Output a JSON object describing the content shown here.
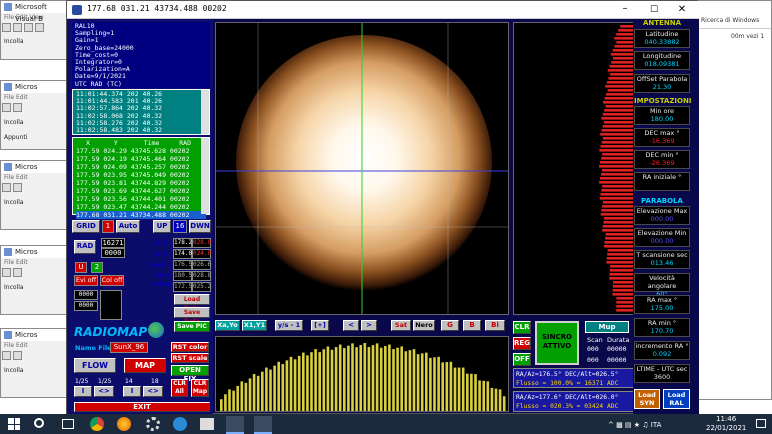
{
  "window": {
    "title": "177.68 031.21  43734.488 00202"
  },
  "bg_windows": [
    {
      "title": "Microsoft Visual B",
      "menu": "File  Edit  View"
    },
    {
      "title": "Micros",
      "menu": "File  Edit"
    },
    {
      "title": "Micros",
      "menu": "File  Edit"
    },
    {
      "title": "Micros",
      "menu": "File  Edit"
    },
    {
      "title": "Micros",
      "menu": "File  Edit"
    }
  ],
  "bg_labels": {
    "incolla": "Incolla",
    "appunti": "Appunti",
    "a_blank": "Il_Mi"
  },
  "info_panel": [
    "RAL10",
    "Sampling=1",
    "Gain=1",
    "Zero_base=24000",
    "Time_cost=0",
    "Integrator=0",
    "Polarization=A",
    "Date=9/1/2021",
    "UTC RAD  (TC)"
  ],
  "utc_list": [
    "11:01:44.374 202 40.26",
    "11:01:44.583 201 40.26",
    "11:02:57.864 202 40.32",
    "11:02:58.068 202 40.32",
    "11:02:58.276 202 40.32",
    "11:02:58.483 202 40.32"
  ],
  "data_list": {
    "headers": [
      "X",
      "Y",
      "Time",
      "RAD"
    ],
    "rows": [
      "177.59 024.29  43745.628 00202",
      "177.59 024.19  43745.464 00202",
      "177.59 024.09  43745.257 00202",
      "177.59 023.95  43745.049 00202",
      "177.59 023.81  43744.829 00202",
      "177.59 023.69  43744.627 00202",
      "177.59 023.56  43744.401 00202",
      "177.59 023.47  43744.244 00202",
      "177.68 031.21  43734.488 00202"
    ]
  },
  "controls": {
    "grid": "GRID",
    "grid_val": "1",
    "auto": "Auto",
    "up": "UP",
    "up_val": "16",
    "dwn": "DWN",
    "rad": "RAD",
    "rad_a": "16271",
    "rad_b": "0000",
    "u": "U",
    "u2": "2",
    "evi_off": "Evi off",
    "col_off": "Col off",
    "xy_lbl": "xl yl",
    "xy_a": "178.2",
    "xy_b": "028.0",
    "xiyi_lbl": "xi yi",
    "xiyi_a": "174.0",
    "xiyi_b": "024.0",
    "centro_lbl": "Centro",
    "centro_a": "176.5",
    "centro_b": "026.6",
    "area_lbl": "Area",
    "area_a": "180.5",
    "area_b": "028.8",
    "colore_lbl": "colore",
    "col_a": "172.5",
    "col_b": "025.2",
    "load_data": "Load Data",
    "save_data": "Save Data",
    "save_pic": "Save PIC",
    "box1": "0000",
    "box2": "0000",
    "radiomap": "RADIOMAP",
    "name_lbl": "Name File",
    "name_val": "SunX_96",
    "rst_color": "RST color",
    "rst_scale": "RST scale",
    "flow": "FLOW",
    "map": "MAP",
    "open_fix": "OPEN FIX",
    "n1": "1/25",
    "n2": "1/25",
    "n3": "14",
    "n4": "18",
    "clr_all": "CLR All",
    "clr_map": "CLR Map",
    "exit": "EXIT",
    "a_lt": "I",
    "a_mid": "<>",
    "a_rt": "I"
  },
  "plot_toolbar": [
    "Xa,Yo",
    "X1,Y1",
    "y/s - 1",
    "[+]",
    "<",
    ">",
    "Sat",
    "Nero",
    "G",
    "B",
    "Bi"
  ],
  "sidebar_btns": {
    "clr": "CLR",
    "reg": "REG",
    "off": "OFF",
    "sincro": "SINCRO ATTIVO",
    "mup": "Mup",
    "scan": "Scan",
    "durata": "Durata",
    "s1": "000",
    "s2": "00000",
    "s3": "000",
    "s4": "00000"
  },
  "readout": {
    "l1": "RA/Az=176.5° DEC/Alt=026.5°",
    "l2": "Flusso = 100.0% = 16371 ADC",
    "l3": "RA/Az=177.6° DEC/Alt=026.0°",
    "l4": "Flusso = 020.3% = 03424 ADC"
  },
  "right_panel": {
    "antenna_title": "ANTENNA",
    "lat_n": "Latitudine",
    "lat_v": "040.33882",
    "lon_n": "Longitudine",
    "lon_v": "018.09381",
    "off_n": "OffSet Parabola",
    "off_v": "21.30",
    "imp_title": "IMPOSTAZIONI",
    "min_n": "Min ore",
    "min_v": "180.00",
    "decmax_n": "DEC max °",
    "decmax_v": "-16.369",
    "decmin_n": "DEC min °",
    "decmin_v": "-26.369",
    "ra_n": "RA iniziale °",
    "ra_v": "",
    "par_title": "PARABOLA",
    "elmax_n": "Elevazione Max",
    "elmax_v": "000.00",
    "elmin_n": "Elevazione Min",
    "elmin_v": "000.00",
    "temp_n": "T scansione sec",
    "temp_v": "013.46",
    "vel_n": "Velocità angolare",
    "vel_v": "60°",
    "ramax_n": "RA max °",
    "ramax_v": "175.00",
    "ramin_n": "RA min °",
    "ramin_v": "170.70",
    "inc_n": "incremento RA °",
    "inc_v": "0.092",
    "ltime_n": "LTIME - UTC sec",
    "ltime_v": "3600",
    "load_syn": "Load SYN",
    "load_ral": "Load RAL"
  },
  "bg_right": {
    "b1": "Ricerca di Windows",
    "b2": "00m vezi 1"
  },
  "taskbar": {
    "time": "11:46",
    "date": "22/01/2021"
  },
  "colors": {
    "navy": "#000080",
    "teal": "#008080",
    "green": "#00c000",
    "yellow": "#c8d000",
    "cyan": "#00d8ff"
  }
}
